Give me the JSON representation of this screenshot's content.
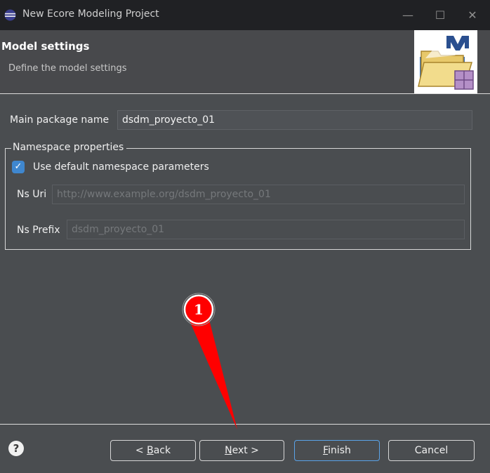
{
  "window": {
    "title": "New Ecore Modeling Project",
    "controls": {
      "minimize": "—",
      "maximize": "☐",
      "close": "✕"
    }
  },
  "header": {
    "title": "Model settings",
    "subtitle": "Define the model settings",
    "image_icon": "ecore-modeling-project-wizard-icon"
  },
  "form": {
    "main_package_label": "Main package name",
    "main_package_value": "dsdm_proyecto_01",
    "namespace_group_label": "Namespace properties",
    "use_default_label": "Use default namespace parameters",
    "use_default_checked": true,
    "ns_uri_label": "Ns Uri",
    "ns_uri_value": "http://www.example.org/dsdm_proyecto_01",
    "ns_prefix_label": "Ns Prefix",
    "ns_prefix_value": "dsdm_proyecto_01"
  },
  "footer": {
    "help_icon": "?",
    "back_prefix": "< ",
    "back_mnemonic": "B",
    "back_rest": "ack",
    "next_mnemonic": "N",
    "next_rest": "ext >",
    "finish_mnemonic": "F",
    "finish_rest": "inish",
    "cancel_label": "Cancel"
  },
  "annotation": {
    "step_number": "1",
    "color": "#ff0000"
  },
  "colors": {
    "titlebar": "#202124",
    "dialog_bg": "#4a4d50",
    "accent_blue": "#3f87cf"
  }
}
